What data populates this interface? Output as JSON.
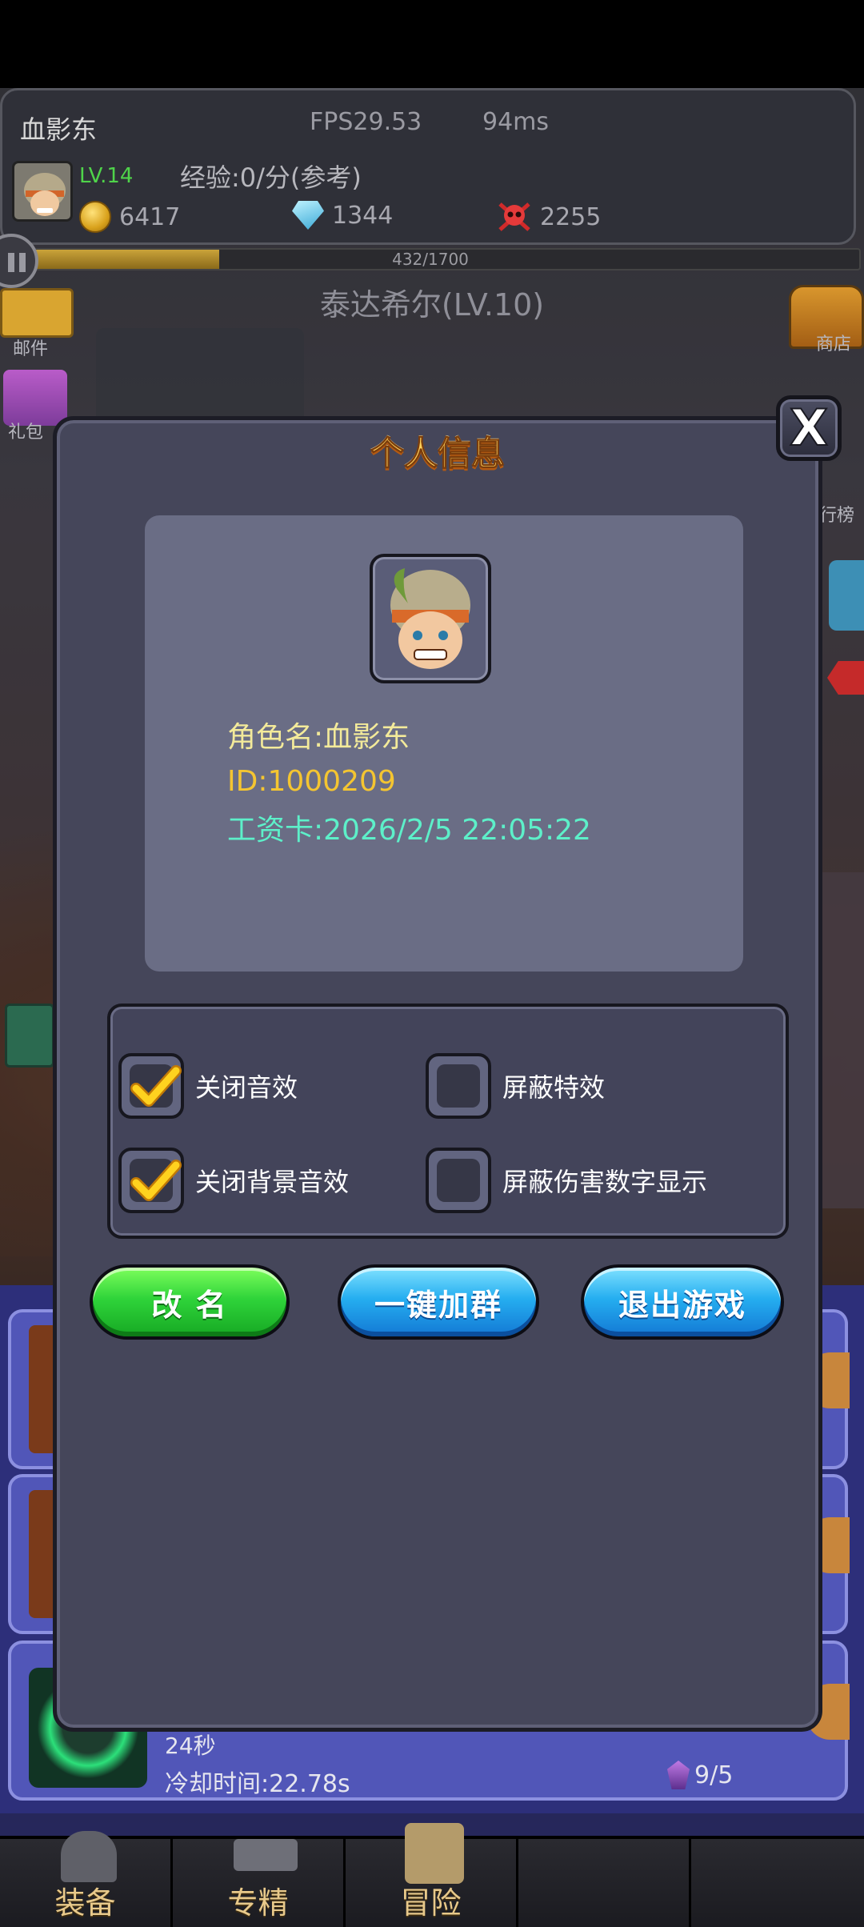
{
  "hud": {
    "player_name": "血影东",
    "fps": "FPS29.53",
    "ping": "94ms",
    "level": "LV.14",
    "exp_rate": "经验:0/分(参考)",
    "gold": "6417",
    "diamonds": "1344",
    "kills": "2255"
  },
  "xp": {
    "text": "432/1700",
    "current": 432,
    "max": 1700
  },
  "stage": "泰达希尔(LV.10)",
  "side": {
    "mail": "邮件",
    "gift": "礼包",
    "shop": "商店",
    "rank": "行榜"
  },
  "lower": {
    "seconds": "24秒",
    "cooldown": "冷却时间:22.78s",
    "crystal": "9/5"
  },
  "bottom_nav": [
    "装备",
    "专精",
    "冒险",
    "",
    ""
  ],
  "modal": {
    "title": "个人信息",
    "close": "X",
    "role_name": "角色名:血影东",
    "id": "ID:1000209",
    "pay_card": "工资卡:2026/2/5 22:05:22",
    "settings": [
      {
        "label": "关闭音效",
        "checked": true
      },
      {
        "label": "屏蔽特效",
        "checked": false
      },
      {
        "label": "关闭背景音效",
        "checked": true
      },
      {
        "label": "屏蔽伤害数字显示",
        "checked": false
      }
    ],
    "buttons": {
      "rename": "改 名",
      "join_group": "一键加群",
      "exit": "退出游戏"
    }
  },
  "colors": {
    "title": "#ffcf5a",
    "id": "#f4c531",
    "card": "#5df0c9",
    "green_button": "#2fd43a",
    "blue_button": "#25aef0"
  },
  "icons": [
    "pause-icon",
    "mail-icon",
    "gift-icon",
    "chest-icon",
    "coin-icon",
    "diamond-icon",
    "skull-icon",
    "check-icon",
    "close-icon",
    "helmet-icon",
    "hammer-icon",
    "scroll-icon"
  ]
}
